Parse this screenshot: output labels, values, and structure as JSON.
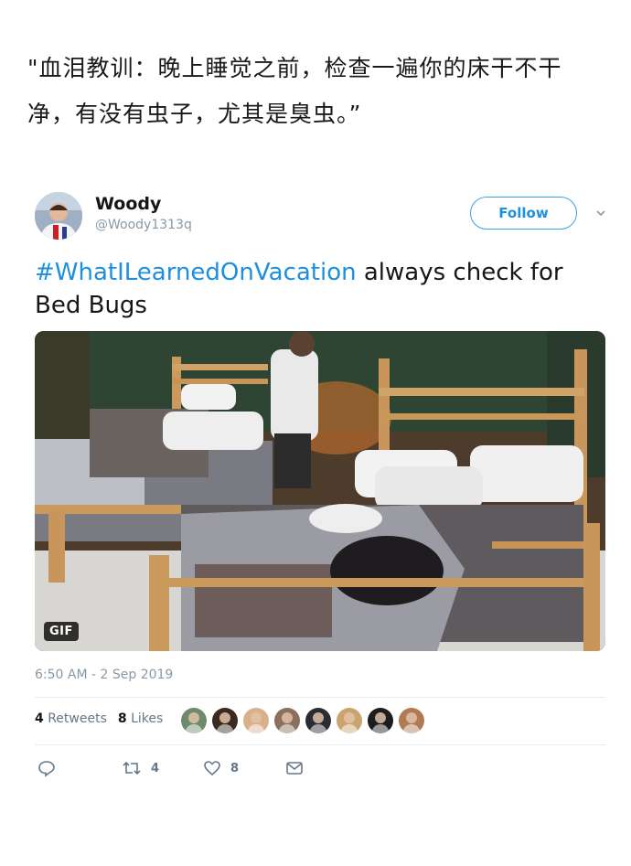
{
  "quote": {
    "text": "\"血泪教训：晚上睡觉之前，检查一遍你的床干不干净，有没有虫子，尤其是臭虫。”"
  },
  "tweet": {
    "user": {
      "name": "Woody",
      "handle": "@Woody1313q"
    },
    "follow_label": "Follow",
    "hashtag": "#WhatILearnedOnVacation",
    "body": " always check for Bed Bugs",
    "media_badge": "GIF",
    "timestamp": "6:50 AM - 2 Sep 2019",
    "stats": {
      "retweets_count": "4",
      "retweets_label": "Retweets",
      "likes_count": "8",
      "likes_label": "Likes"
    },
    "liker_avatar_colors": [
      "#6e8a6b",
      "#3b2a22",
      "#d9b08c",
      "#8c6f5e",
      "#2c2c34",
      "#c9a46e",
      "#1d1d1d",
      "#b07a54"
    ],
    "actions": {
      "reply_icon": "reply-icon",
      "retweet_count": "4",
      "like_count": "8",
      "message_icon": "message-icon"
    },
    "accent": "#1d8fe0"
  }
}
